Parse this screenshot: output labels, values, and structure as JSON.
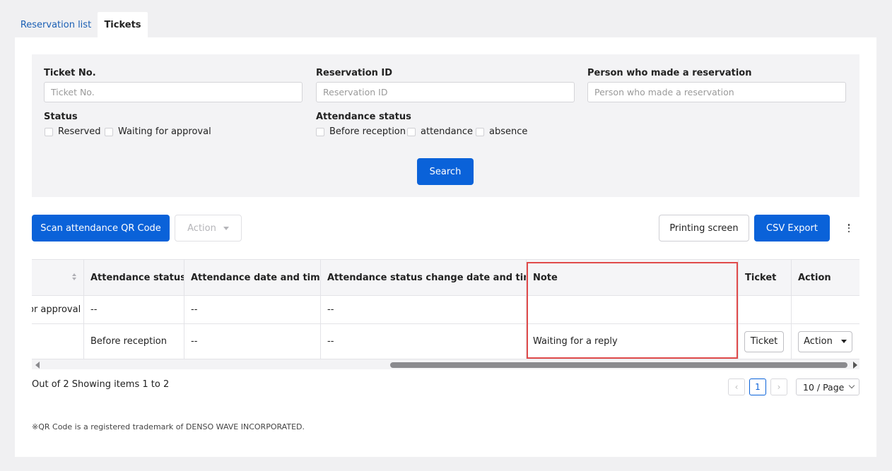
{
  "tabs": [
    {
      "label": "Reservation list"
    },
    {
      "label": "Tickets"
    }
  ],
  "search": {
    "ticket_no": {
      "label": "Ticket No.",
      "placeholder": "Ticket No.",
      "value": ""
    },
    "reservation_id": {
      "label": "Reservation ID",
      "placeholder": "Reservation ID",
      "value": ""
    },
    "person": {
      "label": "Person who made a reservation",
      "placeholder": "Person who made a reservation",
      "value": ""
    },
    "status": {
      "label": "Status",
      "options": [
        {
          "label": "Reserved",
          "checked": false
        },
        {
          "label": "Waiting for approval",
          "checked": false
        }
      ]
    },
    "attendance_status": {
      "label": "Attendance status",
      "options": [
        {
          "label": "Before reception",
          "checked": false
        },
        {
          "label": "attendance",
          "checked": false
        },
        {
          "label": "absence",
          "checked": false
        }
      ]
    },
    "search_button": "Search"
  },
  "toolbar": {
    "scan_button": "Scan attendance QR Code",
    "action_button": "Action",
    "print_button": "Printing screen",
    "csv_button": "CSV Export"
  },
  "table": {
    "columns": [
      "",
      "Attendance status",
      "Attendance date and time",
      "Attendance status change date and time",
      "Note",
      "Ticket",
      "Action"
    ],
    "rows": [
      {
        "status": "Waiting for approval",
        "status_visible": "or approval",
        "attendance_status": "--",
        "attendance_datetime": "--",
        "change_datetime": "--",
        "note": "",
        "ticket_button": "",
        "action_button": ""
      },
      {
        "status": "",
        "status_visible": "",
        "attendance_status": "Before reception",
        "attendance_datetime": "--",
        "change_datetime": "--",
        "note": "Waiting for a reply",
        "ticket_button": "Ticket",
        "action_button": "Action"
      }
    ]
  },
  "pagination": {
    "summary": "Out of 2 Showing items 1 to 2",
    "prev": "‹",
    "current_page": "1",
    "next": "›",
    "page_size": "10 / Page"
  },
  "footnote": "※QR Code is a registered trademark of DENSO WAVE INCORPORATED.",
  "colors": {
    "primary": "#0a62d9",
    "highlight": "#e04a4a",
    "page_bg": "#f0f0f2",
    "filter_bg": "#f3f3f5"
  }
}
